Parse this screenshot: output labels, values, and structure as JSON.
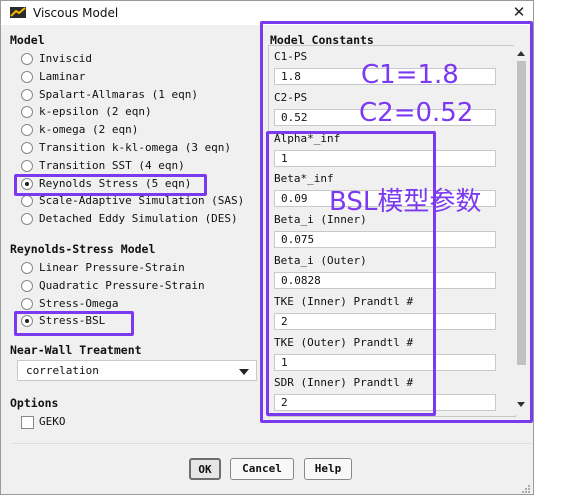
{
  "window": {
    "title": "Viscous Model",
    "close_icon": "close-icon"
  },
  "model": {
    "label": "Model",
    "options": [
      "Inviscid",
      "Laminar",
      "Spalart-Allmaras (1 eqn)",
      "k-epsilon (2 eqn)",
      "k-omega (2 eqn)",
      "Transition k-kl-omega (3 eqn)",
      "Transition SST (4 eqn)",
      "Reynolds Stress (5 eqn)",
      "Scale-Adaptive Simulation (SAS)",
      "Detached Eddy Simulation (DES)"
    ],
    "selected": "Reynolds Stress (5 eqn)"
  },
  "reynolds_stress": {
    "label": "Reynolds-Stress Model",
    "options": [
      "Linear Pressure-Strain",
      "Quadratic Pressure-Strain",
      "Stress-Omega",
      "Stress-BSL"
    ],
    "selected": "Stress-BSL"
  },
  "near_wall": {
    "label": "Near-Wall Treatment",
    "value": "correlation"
  },
  "options": {
    "label": "Options",
    "geko_label": "GEKO",
    "geko_checked": false
  },
  "constants": {
    "label": "Model Constants",
    "items": [
      {
        "label": "C1-PS",
        "value": "1.8"
      },
      {
        "label": "C2-PS",
        "value": "0.52"
      },
      {
        "label": "Alpha*_inf",
        "value": "1"
      },
      {
        "label": "Beta*_inf",
        "value": "0.09"
      },
      {
        "label": "Beta_i (Inner)",
        "value": "0.075"
      },
      {
        "label": "Beta_i (Outer)",
        "value": "0.0828"
      },
      {
        "label": "TKE (Inner) Prandtl #",
        "value": "2"
      },
      {
        "label": "TKE (Outer) Prandtl #",
        "value": "1"
      },
      {
        "label": "SDR (Inner) Prandtl #",
        "value": "2"
      }
    ]
  },
  "annotations": {
    "c1": "C1=1.8",
    "c2": "C2=0.52",
    "bsl": "BSL模型参数",
    "color": "#7b3af0"
  },
  "buttons": {
    "ok": "OK",
    "cancel": "Cancel",
    "help": "Help"
  }
}
